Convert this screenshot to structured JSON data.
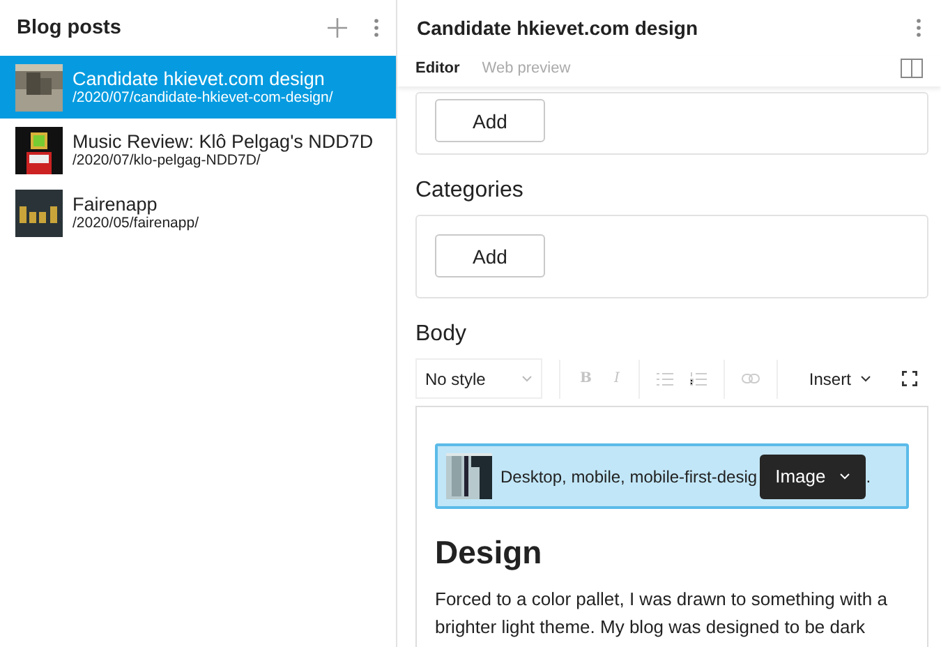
{
  "sidebar": {
    "title": "Blog posts",
    "posts": [
      {
        "title": "Candidate hkievet.com design",
        "path": "/2020/07/candidate-hkievet-com-design/",
        "selected": true
      },
      {
        "title": "Music Review: Klô Pelgag's NDD7D",
        "path": "/2020/07/klo-pelgag-NDD7D/",
        "selected": false
      },
      {
        "title": "Fairenapp",
        "path": "/2020/05/fairenapp/",
        "selected": false
      }
    ]
  },
  "editor": {
    "title": "Candidate hkievet.com design",
    "tabs": [
      {
        "label": "Editor",
        "selected": true
      },
      {
        "label": "Web preview",
        "selected": false
      }
    ],
    "first_field": {
      "button": "Add"
    },
    "categories": {
      "label": "Categories",
      "button": "Add"
    },
    "body": {
      "label": "Body",
      "toolbar": {
        "style": "No style",
        "bold": {
          "label": "B",
          "disabled": true
        },
        "italic": {
          "label": "I",
          "disabled": true
        },
        "lists_disabled": true,
        "link_disabled": true,
        "insert": "Insert"
      },
      "image_block": {
        "caption": "Desktop, mobile, mobile-first-desig",
        "popover": "Image",
        "tail": "."
      },
      "heading": "Design",
      "paragraph": "Forced to a color pallet, I was drawn to something with a brighter light theme. My blog was designed to be dark"
    }
  }
}
